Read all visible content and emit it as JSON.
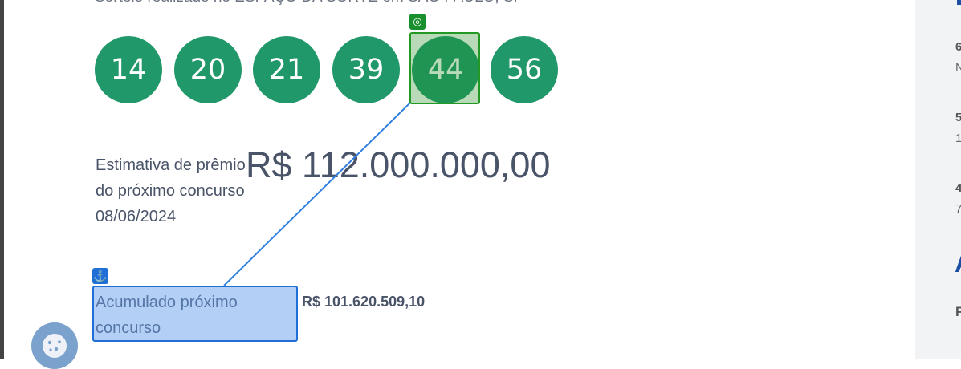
{
  "result": {
    "draw_location_text": "Sorteio realizado no ESPAÇO DA SORTE em SÃO PAULO, SP",
    "balls": [
      "14",
      "20",
      "21",
      "39",
      "44",
      "56"
    ]
  },
  "estimate": {
    "label": "Estimativa de prêmio do próximo concurso 08/06/2024",
    "value": "R$ 112.000.000,00"
  },
  "accumulated": {
    "label": "Acumulado próximo concurso",
    "value": "R$ 101.620.509,10"
  },
  "sidebar": {
    "lines": [
      "6",
      "N",
      "5",
      "1",
      "4",
      "7",
      "A",
      "F"
    ]
  },
  "colors": {
    "ball": "#209869",
    "highlight_target": "#229922",
    "highlight_anchor": "#1f6fd6",
    "sidebar_accent": "#1a4fa3"
  },
  "icons": {
    "target_tag": "target-icon",
    "anchor_tag": "anchor-icon",
    "cookie_button": "cookie-icon"
  }
}
